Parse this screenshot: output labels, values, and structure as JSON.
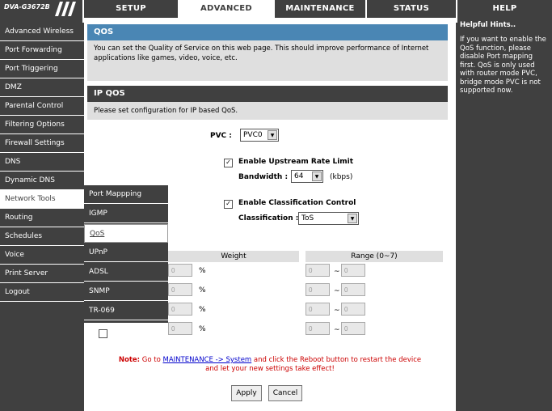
{
  "header": {
    "logo": "DVA-G3672B",
    "tabs": [
      {
        "label": "SETUP"
      },
      {
        "label": "ADVANCED"
      },
      {
        "label": "MAINTENANCE"
      },
      {
        "label": "STATUS"
      },
      {
        "label": "HELP"
      }
    ]
  },
  "sidebar": {
    "items": [
      {
        "label": "Advanced Wireless"
      },
      {
        "label": "Port Forwarding"
      },
      {
        "label": "Port Triggering"
      },
      {
        "label": "DMZ"
      },
      {
        "label": "Parental Control"
      },
      {
        "label": "Filtering Options"
      },
      {
        "label": "Firewall Settings"
      },
      {
        "label": "DNS"
      },
      {
        "label": "Dynamic DNS"
      },
      {
        "label": "Network Tools"
      },
      {
        "label": "Routing"
      },
      {
        "label": "Schedules"
      },
      {
        "label": "Voice"
      },
      {
        "label": "Print Server"
      },
      {
        "label": "Logout"
      }
    ]
  },
  "submenu": {
    "items": [
      {
        "label": "Port Mappping"
      },
      {
        "label": "IGMP"
      },
      {
        "label": "QoS"
      },
      {
        "label": "UPnP"
      },
      {
        "label": "ADSL"
      },
      {
        "label": "SNMP"
      },
      {
        "label": "TR-069"
      }
    ]
  },
  "qos": {
    "title": "QOS",
    "description": "You can set the Quality of Service on this web page. This should improve performance of Internet applications like games, video, voice, etc."
  },
  "ipqos": {
    "title": "IP QOS",
    "intro": "Please set configuration for IP based QoS.",
    "pvc_label": "PVC :",
    "pvc_value": "PVC0",
    "upstream_label": "Enable Upstream Rate Limit",
    "bandwidth_label": "Bandwidth :",
    "bandwidth_value": "64",
    "bandwidth_unit": "(kbps)",
    "classification_enable_label": "Enable Classification Control",
    "classification_label": "Classification :",
    "classification_value": "ToS",
    "weight_header": "Weight",
    "range_header": "Range (0~7)",
    "rows": [
      {
        "weight": "0",
        "percent": "%",
        "range_from": "0",
        "tilde": "~",
        "range_to": "0"
      },
      {
        "weight": "0",
        "percent": "%",
        "range_from": "0",
        "tilde": "~",
        "range_to": "0"
      },
      {
        "weight": "0",
        "percent": "%",
        "range_from": "0",
        "tilde": "~",
        "range_to": "0"
      },
      {
        "weight": "0",
        "percent": "%",
        "range_from": "0",
        "tilde": "~",
        "range_to": "0"
      }
    ]
  },
  "note": {
    "prefix": "Note:",
    "text1": " Go to ",
    "link": "MAINTENANCE -> System",
    "text2": " and click the Reboot button to restart the device",
    "text3": "and let your new settings take effect!"
  },
  "buttons": {
    "apply": "Apply",
    "cancel": "Cancel"
  },
  "hints": {
    "title": "Helpful Hints..",
    "text": "If you want to enable the QoS function, please disable Port mapping first. QoS is only used with router mode PVC, bridge mode PVC is not supported now."
  }
}
